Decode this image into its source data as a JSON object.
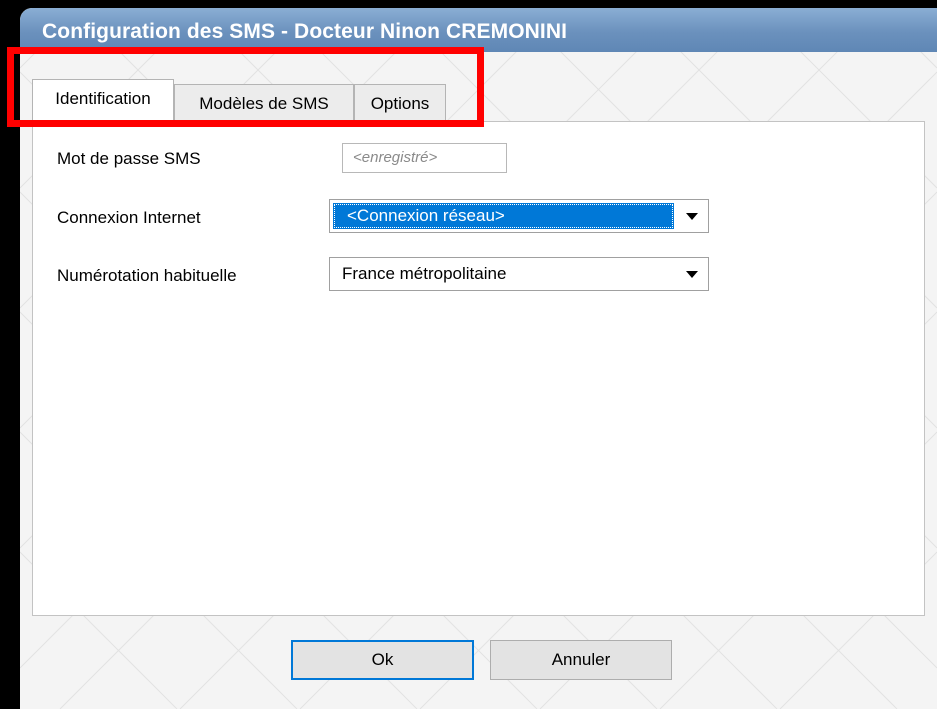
{
  "window": {
    "title": "Configuration des SMS - Docteur Ninon CREMONINI"
  },
  "tabs": [
    {
      "label": "Identification",
      "active": true
    },
    {
      "label": "Modèles de SMS",
      "active": false
    },
    {
      "label": "Options",
      "active": false
    }
  ],
  "form": {
    "password_label": "Mot de passe SMS",
    "password_value": "<enregistré>",
    "connection_label": "Connexion Internet",
    "connection_value": "<Connexion réseau>",
    "numbering_label": "Numérotation habituelle",
    "numbering_value": "France métropolitaine"
  },
  "buttons": {
    "ok": "Ok",
    "cancel": "Annuler"
  },
  "colors": {
    "titlebar": "#6b91bd",
    "selection": "#0078d7",
    "highlight_box": "#ff0000"
  }
}
